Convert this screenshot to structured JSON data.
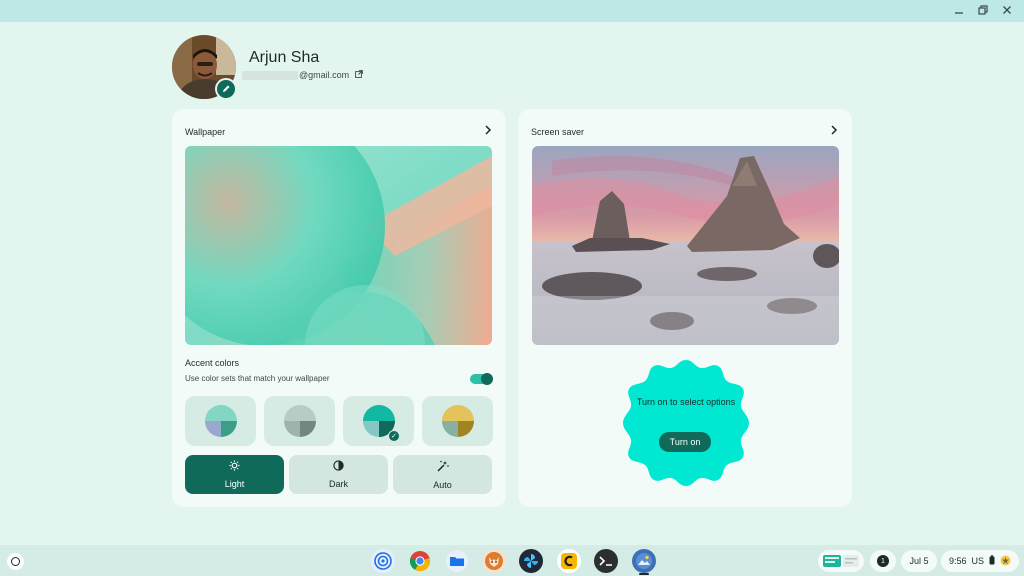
{
  "window": {
    "controls": [
      "minimize",
      "restore",
      "close"
    ]
  },
  "profile": {
    "name": "Arjun Sha",
    "email_suffix": "@gmail.com"
  },
  "wallpaper": {
    "title": "Wallpaper",
    "accent_title": "Accent colors",
    "accent_subtitle": "Use color sets that match your wallpaper",
    "accent_toggle_on": true,
    "color_sets": [
      {
        "top": "#83d5c4",
        "bottom_left": "#9aa7cf",
        "bottom_right": "#3b9e86",
        "selected": false
      },
      {
        "top": "#b9cbc6",
        "bottom_left": "#9fb3ad",
        "bottom_right": "#73877f",
        "selected": false
      },
      {
        "top": "#12b8a0",
        "bottom_left": "#84c7c4",
        "bottom_right": "#0f6a5a",
        "selected": true
      },
      {
        "top": "#e3c35a",
        "bottom_left": "#85b0a2",
        "bottom_right": "#a08323",
        "selected": false
      }
    ],
    "modes": [
      {
        "label": "Light",
        "icon": "brightness-icon",
        "active": true
      },
      {
        "label": "Dark",
        "icon": "contrast-icon",
        "active": false
      },
      {
        "label": "Auto",
        "icon": "magic-wand-icon",
        "active": false
      }
    ]
  },
  "screensaver": {
    "title": "Screen saver",
    "prompt": "Turn on to select options",
    "button_label": "Turn on"
  },
  "shelf": {
    "apps": [
      "podcast-icon",
      "chrome-icon",
      "files-icon",
      "fox-app-icon",
      "pinwheel-app-icon",
      "c-app-icon",
      "terminal-icon",
      "wallpaper-app-icon"
    ],
    "notification_count": "1",
    "date": "Jul 5",
    "time": "9:56",
    "locale": "US"
  }
}
